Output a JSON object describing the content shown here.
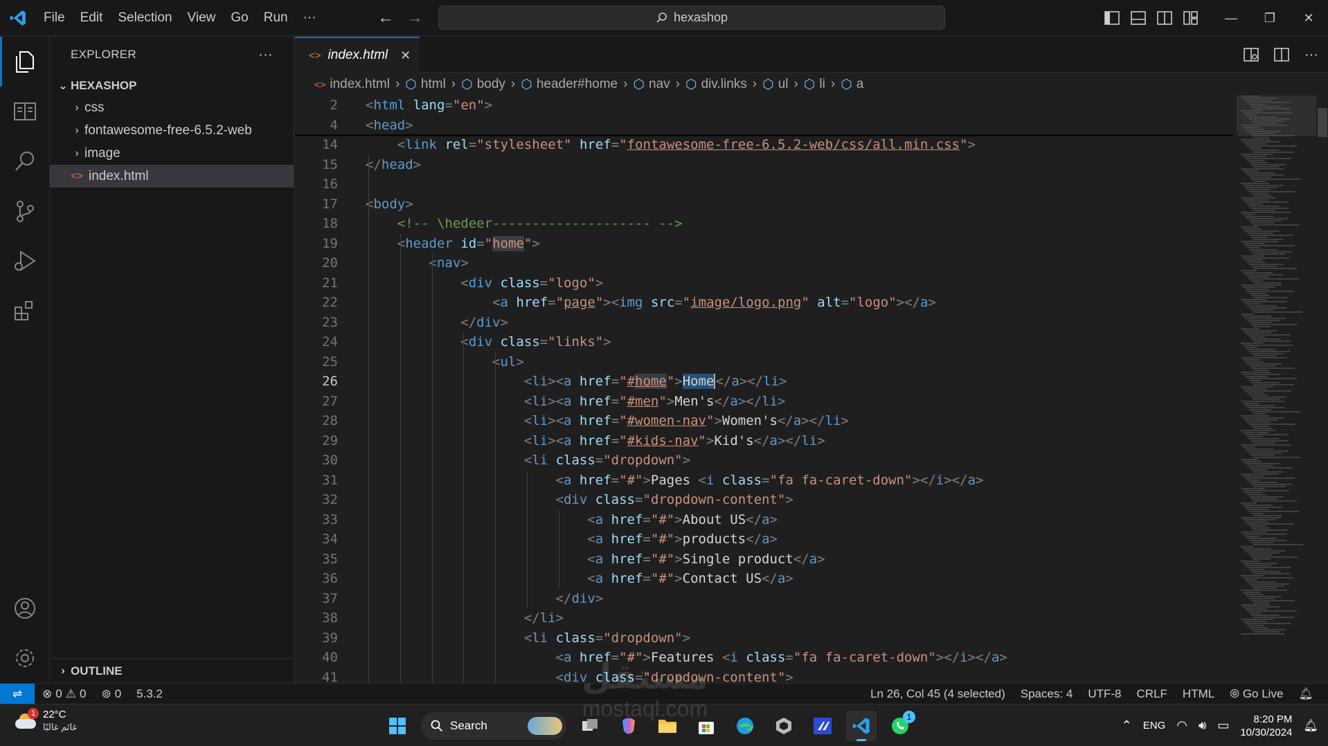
{
  "titlebar": {
    "menus": [
      "File",
      "Edit",
      "Selection",
      "View",
      "Go",
      "Run",
      "···"
    ],
    "search_text": "hexashop"
  },
  "explorer": {
    "header": "EXPLORER",
    "more": "···",
    "root": "HEXASHOP",
    "items": [
      {
        "label": "css",
        "type": "folder"
      },
      {
        "label": "fontawesome-free-6.5.2-web",
        "type": "folder"
      },
      {
        "label": "image",
        "type": "folder"
      },
      {
        "label": "index.html",
        "type": "file",
        "selected": true
      }
    ],
    "outline": "OUTLINE"
  },
  "tab": {
    "label": "index.html",
    "close": "✕"
  },
  "breadcrumbs": [
    "index.html",
    "html",
    "body",
    "header#home",
    "nav",
    "div.links",
    "ul",
    "li",
    "a"
  ],
  "editor": {
    "current_line": 26,
    "lines": [
      {
        "n": "2",
        "html": "<span class='t'>&lt;</span><span class='n'>html</span> <span class='a'>lang</span><span class='t'>=</span><span class='s'>\"en\"</span><span class='t'>&gt;</span>"
      },
      {
        "n": "4",
        "html": "<span class='t'>&lt;</span><span class='n'>head</span><span class='t'>&gt;</span>"
      },
      {
        "n": "14",
        "html": "    <span class='t'>&lt;</span><span class='n'>link</span> <span class='a'>rel</span><span class='t'>=</span><span class='s'>\"stylesheet\"</span> <span class='a'>href</span><span class='t'>=</span><span class='s'>\"<span class='u'>fontawesome-free-6.5.2-web/css/all.min.css</span>\"</span><span class='t'>&gt;</span>"
      },
      {
        "n": "15",
        "html": "<span class='t'>&lt;/</span><span class='n'>head</span><span class='t'>&gt;</span>"
      },
      {
        "n": "16",
        "html": ""
      },
      {
        "n": "17",
        "html": "<span class='t'>&lt;</span><span class='n'>body</span><span class='t'>&gt;</span>"
      },
      {
        "n": "18",
        "html": "    <span class='c'>&lt;!-- \\hedeer-------------------- --&gt;</span>"
      },
      {
        "n": "19",
        "html": "    <span class='t'>&lt;</span><span class='n'>header</span> <span class='a'>id</span><span class='t'>=</span><span class='s'>\"<span class='hl'>home</span>\"</span><span class='t'>&gt;</span>"
      },
      {
        "n": "20",
        "html": "        <span class='t'>&lt;</span><span class='n'>nav</span><span class='t'>&gt;</span>"
      },
      {
        "n": "21",
        "html": "            <span class='t'>&lt;</span><span class='n'>div</span> <span class='a'>class</span><span class='t'>=</span><span class='s'>\"logo\"</span><span class='t'>&gt;</span>"
      },
      {
        "n": "22",
        "html": "                <span class='t'>&lt;</span><span class='n'>a</span> <span class='a'>href</span><span class='t'>=</span><span class='s'>\"<span class='u'>page</span>\"</span><span class='t'>&gt;&lt;</span><span class='n'>img</span> <span class='a'>src</span><span class='t'>=</span><span class='s'>\"<span class='u'>image/logo.png</span>\"</span> <span class='a'>alt</span><span class='t'>=</span><span class='s'>\"logo\"</span><span class='t'>&gt;&lt;/</span><span class='n'>a</span><span class='t'>&gt;</span>"
      },
      {
        "n": "23",
        "html": "            <span class='t'>&lt;/</span><span class='n'>div</span><span class='t'>&gt;</span>"
      },
      {
        "n": "24",
        "html": "            <span class='t'>&lt;</span><span class='n'>div</span> <span class='a'>class</span><span class='t'>=</span><span class='s'>\"links\"</span><span class='t'>&gt;</span>"
      },
      {
        "n": "25",
        "html": "                <span class='t'>&lt;</span><span class='n'>ul</span><span class='t'>&gt;</span>"
      },
      {
        "n": "26",
        "html": "                    <span class='t'>&lt;</span><span class='n'>li</span><span class='t'>&gt;&lt;</span><span class='n'>a</span> <span class='a'>href</span><span class='t'>=</span><span class='s'>\"<span class='u'>#<span class='hl'>home</span></span>\"</span><span class='t'>&gt;</span><span class='sel'>Home</span><span class='cursor'></span><span class='t'>&lt;/</span><span class='n'>a</span><span class='t'>&gt;&lt;/</span><span class='n'>li</span><span class='t'>&gt;</span>"
      },
      {
        "n": "27",
        "html": "                    <span class='t'>&lt;</span><span class='n'>li</span><span class='t'>&gt;&lt;</span><span class='n'>a</span> <span class='a'>href</span><span class='t'>=</span><span class='s'>\"<span class='u'>#men</span>\"</span><span class='t'>&gt;</span>Men's<span class='t'>&lt;/</span><span class='n'>a</span><span class='t'>&gt;&lt;/</span><span class='n'>li</span><span class='t'>&gt;</span>"
      },
      {
        "n": "28",
        "html": "                    <span class='t'>&lt;</span><span class='n'>li</span><span class='t'>&gt;&lt;</span><span class='n'>a</span> <span class='a'>href</span><span class='t'>=</span><span class='s'>\"<span class='u'>#women-nav</span>\"</span><span class='t'>&gt;</span>Women's<span class='t'>&lt;/</span><span class='n'>a</span><span class='t'>&gt;&lt;/</span><span class='n'>li</span><span class='t'>&gt;</span>"
      },
      {
        "n": "29",
        "html": "                    <span class='t'>&lt;</span><span class='n'>li</span><span class='t'>&gt;&lt;</span><span class='n'>a</span> <span class='a'>href</span><span class='t'>=</span><span class='s'>\"<span class='u'>#kids-nav</span>\"</span><span class='t'>&gt;</span>Kid's<span class='t'>&lt;/</span><span class='n'>a</span><span class='t'>&gt;&lt;/</span><span class='n'>li</span><span class='t'>&gt;</span>"
      },
      {
        "n": "30",
        "html": "                    <span class='t'>&lt;</span><span class='n'>li</span> <span class='a'>class</span><span class='t'>=</span><span class='s'>\"dropdown\"</span><span class='t'>&gt;</span>"
      },
      {
        "n": "31",
        "html": "                        <span class='t'>&lt;</span><span class='n'>a</span> <span class='a'>href</span><span class='t'>=</span><span class='s'>\"#\"</span><span class='t'>&gt;</span>Pages <span class='t'>&lt;</span><span class='n'>i</span> <span class='a'>class</span><span class='t'>=</span><span class='s'>\"fa fa-caret-down\"</span><span class='t'>&gt;&lt;/</span><span class='n'>i</span><span class='t'>&gt;&lt;/</span><span class='n'>a</span><span class='t'>&gt;</span>"
      },
      {
        "n": "32",
        "html": "                        <span class='t'>&lt;</span><span class='n'>div</span> <span class='a'>class</span><span class='t'>=</span><span class='s'>\"dropdown-content\"</span><span class='t'>&gt;</span>"
      },
      {
        "n": "33",
        "html": "                            <span class='t'>&lt;</span><span class='n'>a</span> <span class='a'>href</span><span class='t'>=</span><span class='s'>\"#\"</span><span class='t'>&gt;</span>About US<span class='t'>&lt;/</span><span class='n'>a</span><span class='t'>&gt;</span>"
      },
      {
        "n": "34",
        "html": "                            <span class='t'>&lt;</span><span class='n'>a</span> <span class='a'>href</span><span class='t'>=</span><span class='s'>\"#\"</span><span class='t'>&gt;</span>products<span class='t'>&lt;/</span><span class='n'>a</span><span class='t'>&gt;</span>"
      },
      {
        "n": "35",
        "html": "                            <span class='t'>&lt;</span><span class='n'>a</span> <span class='a'>href</span><span class='t'>=</span><span class='s'>\"#\"</span><span class='t'>&gt;</span>Single product<span class='t'>&lt;/</span><span class='n'>a</span><span class='t'>&gt;</span>"
      },
      {
        "n": "36",
        "html": "                            <span class='t'>&lt;</span><span class='n'>a</span> <span class='a'>href</span><span class='t'>=</span><span class='s'>\"#\"</span><span class='t'>&gt;</span>Contact US<span class='t'>&lt;/</span><span class='n'>a</span><span class='t'>&gt;</span>"
      },
      {
        "n": "37",
        "html": "                        <span class='t'>&lt;/</span><span class='n'>div</span><span class='t'>&gt;</span>"
      },
      {
        "n": "38",
        "html": "                    <span class='t'>&lt;/</span><span class='n'>li</span><span class='t'>&gt;</span>"
      },
      {
        "n": "39",
        "html": "                    <span class='t'>&lt;</span><span class='n'>li</span> <span class='a'>class</span><span class='t'>=</span><span class='s'>\"dropdown\"</span><span class='t'>&gt;</span>"
      },
      {
        "n": "40",
        "html": "                        <span class='t'>&lt;</span><span class='n'>a</span> <span class='a'>href</span><span class='t'>=</span><span class='s'>\"#\"</span><span class='t'>&gt;</span>Features <span class='t'>&lt;</span><span class='n'>i</span> <span class='a'>class</span><span class='t'>=</span><span class='s'>\"fa fa-caret-down\"</span><span class='t'>&gt;&lt;/</span><span class='n'>i</span><span class='t'>&gt;&lt;/</span><span class='n'>a</span><span class='t'>&gt;</span>"
      },
      {
        "n": "41",
        "html": "                        <span class='t'>&lt;</span><span class='n'>div</span> <span class='a'>class</span><span class='t'>=</span><span class='s'>\"dropdown-content\"</span><span class='t'>&gt;</span>"
      }
    ]
  },
  "statusbar": {
    "errors": "0",
    "warnings": "0",
    "ports": "0",
    "version": "5.3.2",
    "position": "Ln 26, Col 45 (4 selected)",
    "spaces": "Spaces: 4",
    "encoding": "UTF-8",
    "eol": "CRLF",
    "language": "HTML",
    "golive": "Go Live"
  },
  "taskbar": {
    "weather_temp": "22°C",
    "weather_desc": "غائم غالبًا",
    "weather_badge": "1",
    "search": "Search",
    "lang": "ENG",
    "time": "8:20 PM",
    "date": "10/30/2024",
    "whatsapp_badge": "1"
  },
  "watermark": {
    "line1": "مستقل",
    "line2": "mostaql.com"
  },
  "colors": {
    "accent": "#0078d4",
    "tag": "#569cd6",
    "attr": "#9cdcfe",
    "string": "#ce9178",
    "comment": "#6a9955"
  }
}
